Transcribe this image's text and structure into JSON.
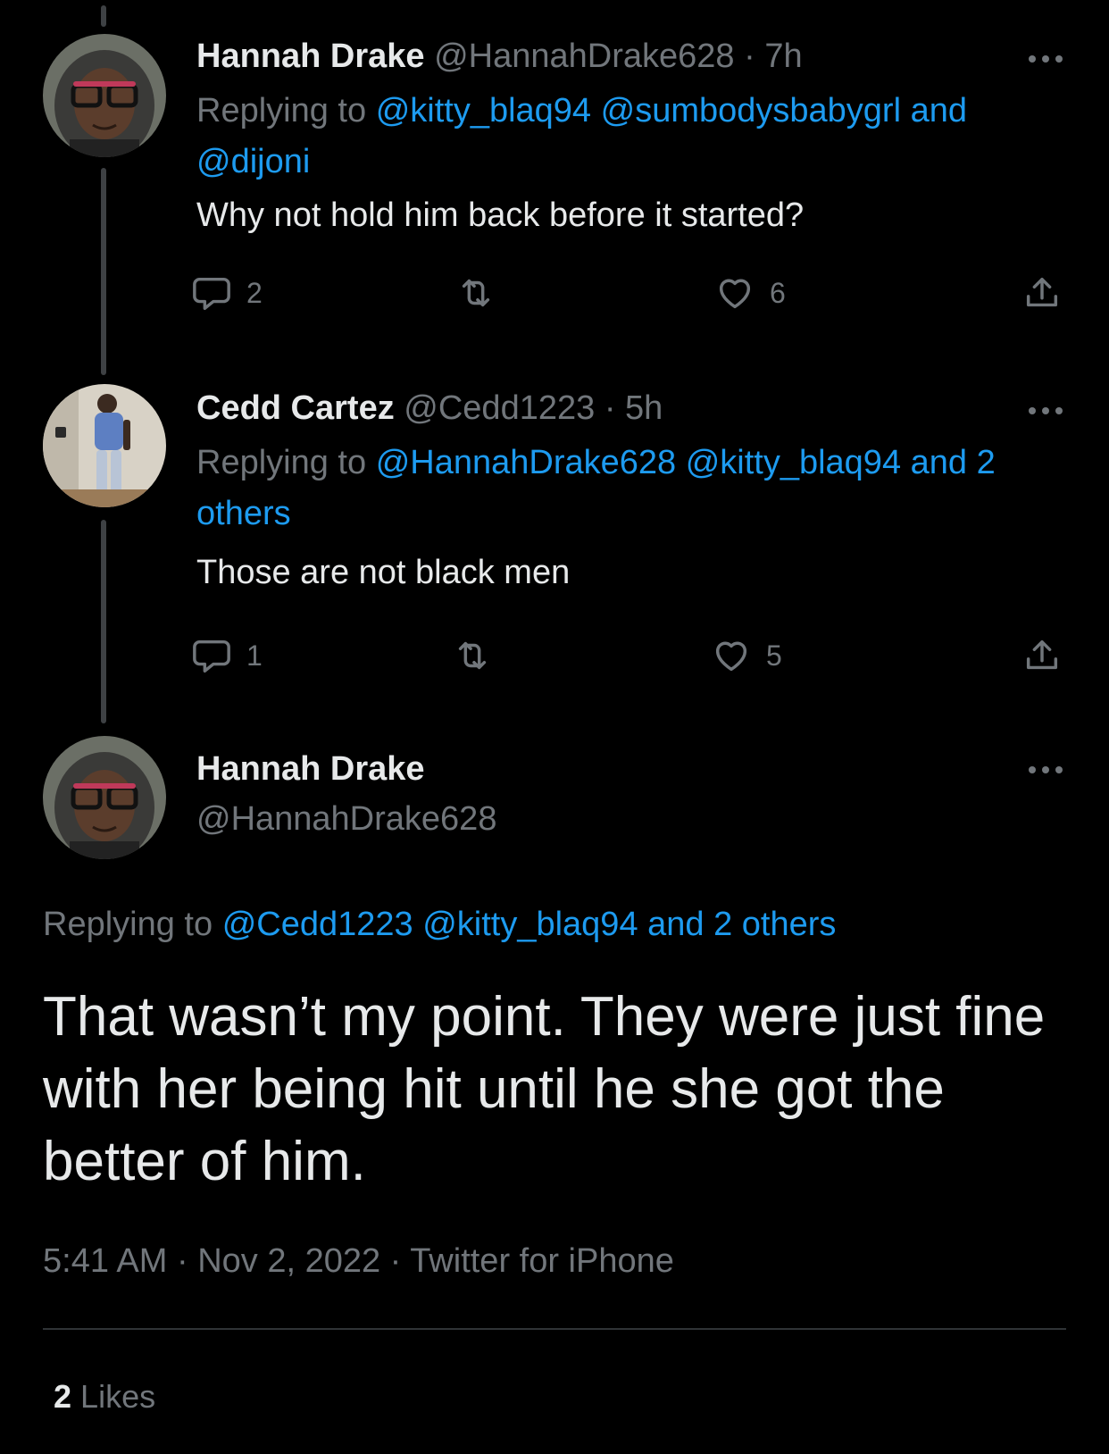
{
  "thread": [
    {
      "name": "Hannah Drake",
      "handle": "@HannahDrake628",
      "time": "· 7h",
      "replying_prefix": "Replying to",
      "replying_links": "@kitty_blaq94 @sumbodysbabygrl and @dijoni",
      "text": "Why not hold him back before it started?",
      "reply_count": "2",
      "retweet_count": "",
      "like_count": "6"
    },
    {
      "name": "Cedd Cartez",
      "handle": "@Cedd1223",
      "time": "· 5h",
      "replying_prefix": "Replying to",
      "replying_links": "@HannahDrake628 @kitty_blaq94 and 2 others",
      "text": "Those are not black men",
      "reply_count": "1",
      "retweet_count": "",
      "like_count": "5"
    }
  ],
  "main_tweet": {
    "name": "Hannah Drake",
    "handle": "@HannahDrake628",
    "replying_prefix": "Replying to",
    "replying_links": "@Cedd1223 @kitty_blaq94 and 2 others",
    "text": "That wasn’t my point. They were just fine with her being hit until he she got the better of him.",
    "timestamp": "5:41 AM · Nov 2, 2022 · Twitter for iPhone",
    "likes_count": "2",
    "likes_label": "Likes"
  },
  "icons": {
    "reply": "comment-icon",
    "retweet": "retweet-icon",
    "like": "heart-icon",
    "share": "share-icon",
    "more": "more-icon"
  },
  "colors": {
    "background": "#000000",
    "text": "#e7e9ea",
    "muted": "#71767b",
    "link": "#1d9bf0",
    "divider": "#2f3336"
  }
}
